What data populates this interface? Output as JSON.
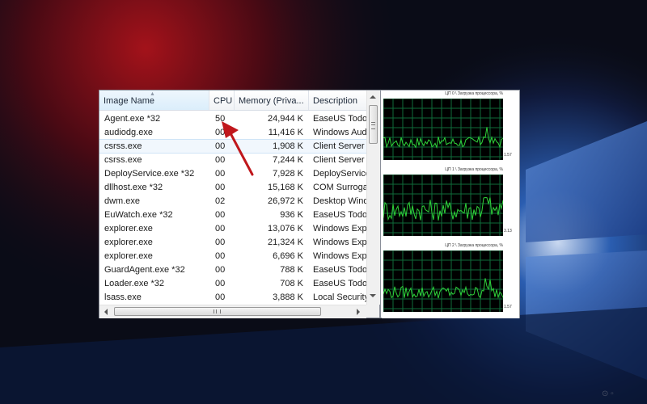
{
  "process_list": {
    "columns": {
      "image_name": "Image Name",
      "cpu": "CPU",
      "memory": "Memory (Priva...",
      "description": "Description"
    },
    "rows": [
      {
        "name": "Agent.exe *32",
        "cpu": "50",
        "memory": "24,944 K",
        "description": "EaseUS Todo"
      },
      {
        "name": "audiodg.exe",
        "cpu": "00",
        "memory": "11,416 K",
        "description": "Windows Aud"
      },
      {
        "name": "csrss.exe",
        "cpu": "00",
        "memory": "1,908 K",
        "description": "Client Server"
      },
      {
        "name": "csrss.exe",
        "cpu": "00",
        "memory": "7,244 K",
        "description": "Client Server"
      },
      {
        "name": "DeployService.exe *32",
        "cpu": "00",
        "memory": "7,928 K",
        "description": "DeployService"
      },
      {
        "name": "dllhost.exe *32",
        "cpu": "00",
        "memory": "15,168 K",
        "description": "COM Surrogat"
      },
      {
        "name": "dwm.exe",
        "cpu": "02",
        "memory": "26,972 K",
        "description": "Desktop Wind"
      },
      {
        "name": "EuWatch.exe *32",
        "cpu": "00",
        "memory": "936 K",
        "description": "EaseUS Todo"
      },
      {
        "name": "explorer.exe",
        "cpu": "00",
        "memory": "13,076 K",
        "description": "Windows Expl"
      },
      {
        "name": "explorer.exe",
        "cpu": "00",
        "memory": "21,324 K",
        "description": "Windows Expl"
      },
      {
        "name": "explorer.exe",
        "cpu": "00",
        "memory": "6,696 K",
        "description": "Windows Expl"
      },
      {
        "name": "GuardAgent.exe *32",
        "cpu": "00",
        "memory": "788 K",
        "description": "EaseUS Todo"
      },
      {
        "name": "Loader.exe *32",
        "cpu": "00",
        "memory": "708 K",
        "description": "EaseUS Todo"
      },
      {
        "name": "lsass.exe",
        "cpu": "00",
        "memory": "3,888 K",
        "description": "Local Security"
      }
    ]
  },
  "cpu_graphs": [
    {
      "title": "ЦП 0 \\ Загрузка процессора, %",
      "value": "1.57",
      "level_min": 0.2,
      "level_max": 0.38
    },
    {
      "title": "ЦП 1 \\ Загрузка процессора, %",
      "value": "3.13",
      "level_min": 0.25,
      "level_max": 0.6
    },
    {
      "title": "ЦП 2 \\ Загрузка процессора, %",
      "value": "1.57",
      "level_min": 0.22,
      "level_max": 0.42
    }
  ],
  "colors": {
    "graph_line": "#2fd33a",
    "graph_grid": "#0f6b3a",
    "annotation_arrow": "#c0171c",
    "selection": "#f1f7fd"
  },
  "icons": [
    "sort-up-icon",
    "scroll-up-icon",
    "scroll-down-icon",
    "scroll-left-icon",
    "scroll-right-icon",
    "annotation-arrow"
  ]
}
